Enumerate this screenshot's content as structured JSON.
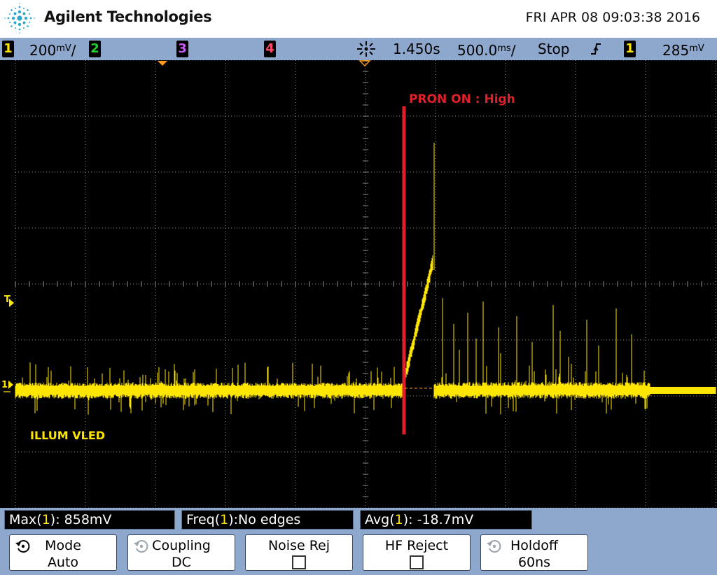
{
  "header": {
    "brand": "Agilent Technologies",
    "datetime": "FRI APR 08 09:03:38 2016"
  },
  "status": {
    "ch1": {
      "num": "1",
      "scale": "200",
      "unit": "mV",
      "suffix": "/"
    },
    "ch2": {
      "num": "2"
    },
    "ch3": {
      "num": "3"
    },
    "ch4": {
      "num": "4"
    },
    "time_delay": "1.450s",
    "time_scale": {
      "value": "500.0",
      "unit": "ms",
      "suffix": "/"
    },
    "run_state": "Stop",
    "trigger_source": "1",
    "trigger_level": {
      "value": "285",
      "unit": "mV"
    }
  },
  "screen": {
    "annotation_red": "PRON ON : High",
    "annotation_yellow": "ILLUM VLED",
    "trigger_marker": "T",
    "ground_marker": "1"
  },
  "measurements": [
    {
      "name": "Max",
      "ch": "1",
      "value": ": 858mV"
    },
    {
      "name": "Freq",
      "ch": "1",
      "value": ":No edges"
    },
    {
      "name": "Avg",
      "ch": "1",
      "value": ": -18.7mV"
    }
  ],
  "softkeys": {
    "mode": {
      "label": "Mode",
      "value": "Auto"
    },
    "coupling": {
      "label": "Coupling",
      "value": "DC"
    },
    "noise_rej": {
      "label": "Noise Rej"
    },
    "hf_reject": {
      "label": "HF Reject"
    },
    "holdoff": {
      "label": "Holdoff",
      "value": "60ns"
    }
  },
  "colors": {
    "ch1": "#ffe600",
    "ch2": "#24d32b",
    "ch3": "#c65cf5",
    "ch4": "#ff4a6a",
    "annotation_red": "#e0202a",
    "statusbar": "#8ea7cc",
    "screen": "#000000",
    "grid": "#8a8a8a"
  }
}
